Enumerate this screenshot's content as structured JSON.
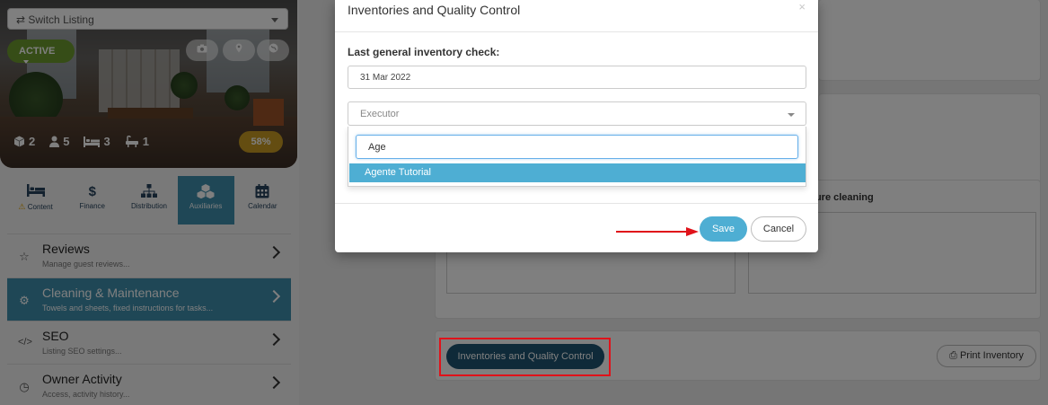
{
  "sidebar": {
    "switch_listing": "⇄ Switch Listing",
    "status_button": "ACTIVE",
    "stats": {
      "units": "2",
      "guests": "5",
      "beds": "3",
      "baths": "1"
    },
    "completion": "58%",
    "tabs": [
      {
        "label": "Content",
        "icon": "bed-icon"
      },
      {
        "label": "Finance",
        "icon": "dollar-icon"
      },
      {
        "label": "Distribution",
        "icon": "sitemap-icon"
      },
      {
        "label": "Auxiliaries",
        "icon": "cubes-icon"
      },
      {
        "label": "Calendar",
        "icon": "calendar-icon"
      }
    ],
    "menu": [
      {
        "title": "Reviews",
        "subtitle": "Manage guest reviews...",
        "icon": "star-icon"
      },
      {
        "title": "Cleaning & Maintenance",
        "subtitle": "Towels and sheets, fixed instructions for tasks...",
        "icon": "gear-icon"
      },
      {
        "title": "SEO",
        "subtitle": "Listing SEO settings...",
        "icon": "code-icon"
      },
      {
        "title": "Owner Activity",
        "subtitle": "Access, activity history...",
        "icon": "clock-icon"
      }
    ]
  },
  "main": {
    "departure_label": "rture cleaning",
    "inventories_button": "Inventories and Quality Control",
    "print_button": "Print Inventory"
  },
  "modal": {
    "title": "Inventories and Quality Control",
    "close": "×",
    "last_check_label": "Last general inventory check:",
    "date_value": "31 Mar 2022",
    "executor_placeholder": "Executor",
    "search_value": "Age",
    "option": "Agente Tutorial",
    "save": "Save",
    "cancel": "Cancel"
  },
  "colors": {
    "accent": "#3f8fad",
    "active_green": "#6c9b2f",
    "progress_gold": "#c99b22",
    "dark_button": "#1e5572",
    "highlight_red": "#e0121a",
    "save_blue": "#4eaed3"
  }
}
